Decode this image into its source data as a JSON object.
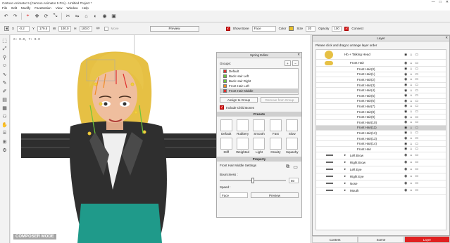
{
  "window": {
    "title": "Cartoon Animator 5 (Cartoon Animator 5 Pro) - Untitled Project *",
    "controls": [
      "—",
      "□",
      "✕"
    ]
  },
  "menu": [
    "File",
    "Edit",
    "Modify",
    "FaceMotion",
    "View",
    "Window",
    "Help"
  ],
  "toolbar_top": {
    "icons": [
      "undo-icon",
      "redo-icon",
      "select-icon",
      "move-icon",
      "rotate-icon",
      "scale-icon",
      "bone-icon",
      "mirror-icon",
      "pin-icon",
      "mask-icon",
      "camera-icon",
      "render-icon"
    ]
  },
  "transform": {
    "x_label": "X",
    "x_value": "-0.2",
    "y_label": "Y",
    "y_value": "179.5",
    "w_label": "W",
    "w_value": "100.0",
    "h_label": "H",
    "h_value": "100.0",
    "move_label": "Move",
    "preview_label": "Preview",
    "show_bone_label": "Show Bone",
    "face_label": "Face",
    "color_label": "Color",
    "size_label": "Size",
    "size_value": "20",
    "opacity_label": "Opacity",
    "opacity_value": "100",
    "connect_label": "Connect"
  },
  "stage": {
    "coord_text": "X: 0.0,   Y: 0.0",
    "mode_label": "COMPOSER MODE"
  },
  "spring": {
    "title": "Spring Editor",
    "groups_label": "Groups:",
    "groups": [
      {
        "name": "Default",
        "color": "#e03030"
      },
      {
        "name": "Back Hair Left",
        "color": "#6cc63a"
      },
      {
        "name": "Back Hair Right",
        "color": "#6cc63a"
      },
      {
        "name": "Front Hair Left",
        "color": "#f08a24"
      },
      {
        "name": "Front Hair Middle",
        "color": "#e03030"
      }
    ],
    "assign_label": "Assign to Group",
    "remove_label": "Remove from Group",
    "include_child_label": "Include Child Bones",
    "presets_header": "Presets",
    "presets": [
      "Default",
      "Rubbery",
      "Smooth",
      "Fast",
      "Slow",
      "Stiff",
      "Weighted",
      "Light",
      "Gravity",
      "Squashy"
    ],
    "property_header": "Property",
    "settings_label": "Front Hair Middle Settings",
    "bounciness_label": "Bounciness :",
    "bounciness_value": "50",
    "speed_label": "Speed :",
    "face_select": "Face",
    "preview_label": "Preview"
  },
  "layer": {
    "title": "Layer",
    "hint": "Please click and drag to arrange layer order",
    "root": "Hb + Talking Head",
    "front_hair": "Front Hair",
    "items": [
      "Front Hair(0)",
      "Front Hair(1)",
      "Front Hair(2)",
      "Front Hair(3)",
      "Front Hair(4)",
      "Front Hair(5)",
      "Front Hair(6)",
      "Front Hair(7)",
      "Front Hair(8)",
      "Front Hair(9)",
      "Front Hair(10)",
      "Front Hair(11)",
      "Front Hair(12)",
      "Front Hair(13)",
      "Front Hair(14)",
      "Front Hair"
    ],
    "selected_index": 11,
    "parts": [
      "Left Brow",
      "Right Brow",
      "Left Eye",
      "Right Eye",
      "Nose",
      "Mouth"
    ]
  },
  "tabs": [
    "Content",
    "Scene",
    "Layer"
  ],
  "colors": {
    "accent": "#e02020",
    "hair": "#e8c44a",
    "jacket": "#2f2f2f",
    "skirt": "#1f9a8a"
  }
}
